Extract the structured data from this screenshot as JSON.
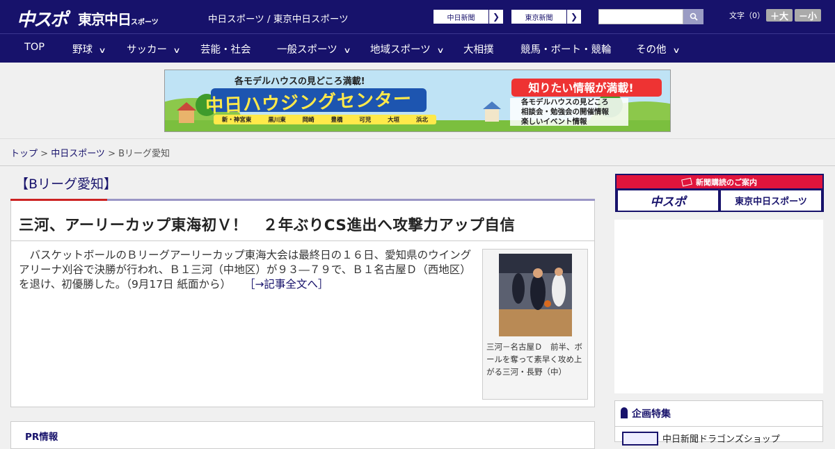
{
  "header": {
    "logo_chuspo": "中スポ",
    "logo_tokyo": "東京中日",
    "logo_tokyo_small": "スポーツ",
    "site_name": "中日スポーツ / 東京中日スポーツ",
    "paper_links": [
      "中日新聞",
      "東京新聞"
    ],
    "search": {
      "placeholder": "",
      "button_icon": "search-icon"
    },
    "font_size_label": "文字（0）",
    "font_larger": "＋大",
    "font_smaller": "－小"
  },
  "nav": [
    {
      "label": "TOP",
      "dropdown": false
    },
    {
      "label": "野球",
      "dropdown": true
    },
    {
      "label": "サッカー",
      "dropdown": true
    },
    {
      "label": "芸能・社会",
      "dropdown": false
    },
    {
      "label": "一般スポーツ",
      "dropdown": true
    },
    {
      "label": "地域スポーツ",
      "dropdown": true
    },
    {
      "label": "大相撲",
      "dropdown": false
    },
    {
      "label": "競馬・ボート・競輪",
      "dropdown": false
    },
    {
      "label": "その他",
      "dropdown": true
    }
  ],
  "ad_banner": {
    "headline": "各モデルハウスの見どころ満載!",
    "name": "中日ハウジングセンター",
    "catch": "知りたい情報が満載!",
    "points": [
      "各モデルハウスの見どころ",
      "相談会・勉強会の開催情報",
      "楽しいイベント情報"
    ],
    "locations": [
      "新・神宮東",
      "黒川東",
      "岡崎",
      "豊橋",
      "可児",
      "大垣",
      "浜北"
    ]
  },
  "breadcrumb": [
    "トップ",
    "中日スポーツ",
    "Bリーグ愛知"
  ],
  "category": "【Bリーグ愛知】",
  "article": {
    "title": "三河、アーリーカップ東海初Ｖ！　２年ぶりCS進出へ攻撃力アップ自信",
    "body": "　バスケットボールのＢリーグアーリーカップ東海大会は最終日の１６日、愛知県のウイングアリーナ刈谷で決勝が行われ、Ｂ１三河（中地区）が９３―７９で、Ｂ１名古屋Ｄ（西地区）を退け、初優勝した。（9月17日 紙面から）",
    "more_link": "［→記事全文へ］",
    "photo_caption": "三河－名古屋Ｄ　前半、ボールを奪って素早く攻め上がる三河・長野（中）"
  },
  "pr": {
    "label": "PR情報"
  },
  "sidebar": {
    "subscribe_head": "新聞購読のご案内",
    "subscribe_links": [
      "中スポ",
      "東京中日スポーツ"
    ],
    "feature_title": "企画特集",
    "feature_item": "中日新聞ドラゴンズショップ"
  },
  "colors": {
    "navy": "#17126b",
    "accent_red": "#e0143c"
  }
}
